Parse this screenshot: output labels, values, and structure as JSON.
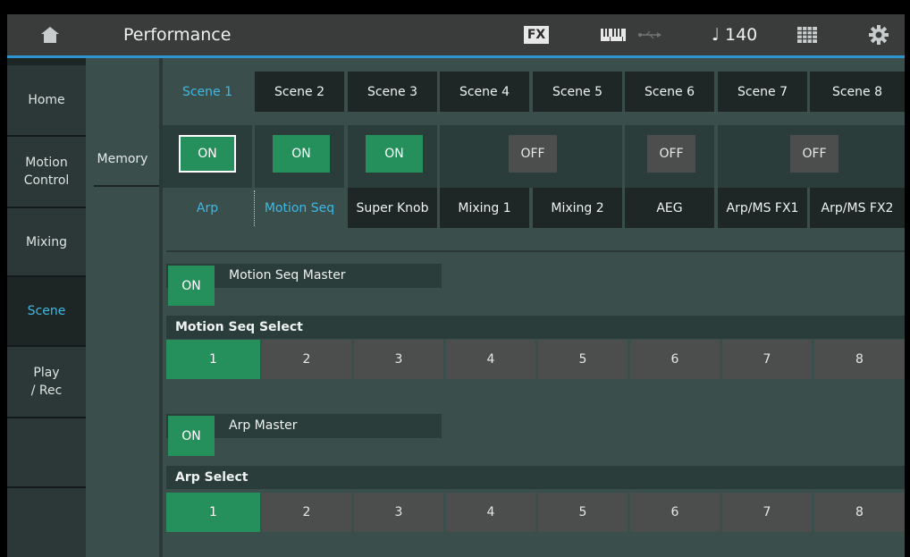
{
  "header": {
    "title": "Performance",
    "fx_label": "FX",
    "tempo": "♩ 140",
    "icons": [
      "home-icon",
      "fx-icon",
      "keyboard-icon",
      "usb-icon",
      "tempo-icon",
      "grid-icon",
      "gear-icon"
    ]
  },
  "nav": {
    "items": [
      "Home",
      "Motion\nControl",
      "Mixing",
      "Scene",
      "Play\n/ Rec"
    ],
    "active": "Scene"
  },
  "sub_label": "Memory",
  "scene_tabs": {
    "items": [
      "Scene 1",
      "Scene 2",
      "Scene 3",
      "Scene 4",
      "Scene 5",
      "Scene 6",
      "Scene 7",
      "Scene 8"
    ],
    "active": "Scene 1"
  },
  "memory_switches": [
    "ON",
    "ON",
    "ON",
    "OFF",
    "OFF",
    "OFF"
  ],
  "category_tabs": {
    "items": [
      "Arp",
      "Motion Seq",
      "Super Knob",
      "Mixing 1",
      "Mixing 2",
      "AEG",
      "Arp/MS FX1",
      "Arp/MS FX2"
    ],
    "active": [
      "Arp",
      "Motion Seq"
    ]
  },
  "motion_seq": {
    "master_label": "Motion Seq Master",
    "master_value": "ON",
    "select_label": "Motion Seq Select",
    "options": [
      "1",
      "2",
      "3",
      "4",
      "5",
      "6",
      "7",
      "8"
    ],
    "selected": "1"
  },
  "arp": {
    "master_label": "Arp Master",
    "master_value": "ON",
    "select_label": "Arp Select",
    "options": [
      "1",
      "2",
      "3",
      "4",
      "5",
      "6",
      "7",
      "8"
    ],
    "selected": "1"
  },
  "colors": {
    "on_green": "#26905c",
    "accent_blue": "#3fb9e4",
    "off_gray": "#4c4e4e",
    "panel": "#3a4e4c"
  }
}
